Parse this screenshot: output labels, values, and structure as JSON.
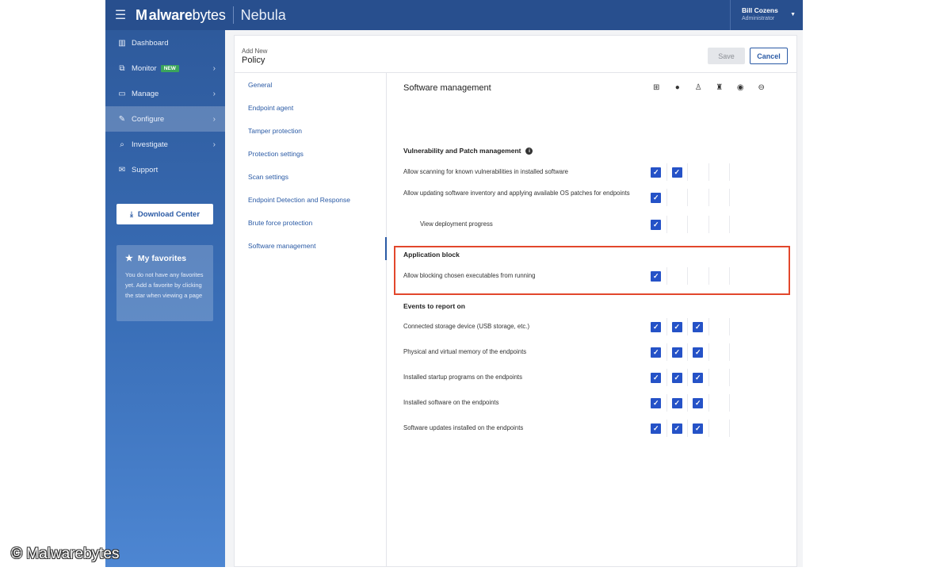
{
  "topbar": {
    "logo_bold": "alware",
    "logo_mark": "M",
    "logo_light": "bytes",
    "product": "Nebula",
    "user_name": "Bill Cozens",
    "user_role": "Administrator"
  },
  "sidebar": {
    "items": [
      {
        "label": "Dashboard",
        "icon": "bar-chart-icon"
      },
      {
        "label": "Monitor",
        "icon": "binoculars-icon",
        "badge": "NEW"
      },
      {
        "label": "Manage",
        "icon": "laptop-icon"
      },
      {
        "label": "Configure",
        "icon": "wrench-icon"
      },
      {
        "label": "Investigate",
        "icon": "search-icon"
      },
      {
        "label": "Support",
        "icon": "chat-icon"
      }
    ],
    "download_label": "Download Center",
    "favorites_title": "My favorites",
    "favorites_text": "You do not have any favorites yet. Add a favorite by clicking the star when viewing a page"
  },
  "page": {
    "subtitle": "Add New",
    "title": "Policy",
    "save_label": "Save",
    "cancel_label": "Cancel"
  },
  "menu": {
    "items": [
      "General",
      "Endpoint agent",
      "Tamper protection",
      "Protection settings",
      "Scan settings",
      "Endpoint Detection and Response",
      "Brute force protection",
      "Software management"
    ],
    "active": "Software management"
  },
  "content": {
    "section_title": "Software management",
    "os_icons": [
      "windows-icon",
      "apple-icon",
      "linux-icon",
      "android-icon",
      "chrome-icon",
      "other-os-icon"
    ],
    "groups": {
      "vuln_title": "Vulnerability and Patch management",
      "app_block_title": "Application block",
      "events_title": "Events to report on"
    },
    "rows": {
      "r1": "Allow scanning for known vulnerabilities in installed software",
      "r2": "Allow updating software inventory and applying available OS patches for endpoints",
      "r3": "View deployment progress",
      "r4": "Allow blocking chosen executables from running",
      "r5": "Connected storage device (USB storage, etc.)",
      "r6": "Physical and virtual memory of the endpoints",
      "r7": "Installed startup programs on the endpoints",
      "r8": "Installed software on the endpoints",
      "r9": "Software updates installed on the endpoints"
    },
    "checked": {
      "r1": [
        true,
        true,
        false,
        false,
        false
      ],
      "r2": [
        true,
        false,
        false,
        false,
        false
      ],
      "r3": [
        true,
        false,
        false,
        false,
        false
      ],
      "r4": [
        true,
        false,
        false,
        false,
        false
      ],
      "r5": [
        true,
        true,
        true,
        false,
        false
      ],
      "r6": [
        true,
        true,
        true,
        false,
        false
      ],
      "r7": [
        true,
        true,
        true,
        false,
        false
      ],
      "r8": [
        true,
        true,
        true,
        false,
        false
      ],
      "r9": [
        true,
        true,
        true,
        false,
        false
      ]
    }
  },
  "watermark": "© Malwarebytes",
  "colors": {
    "topbar": "#284f8e",
    "accent": "#2552c7",
    "highlight": "#e2472c"
  }
}
